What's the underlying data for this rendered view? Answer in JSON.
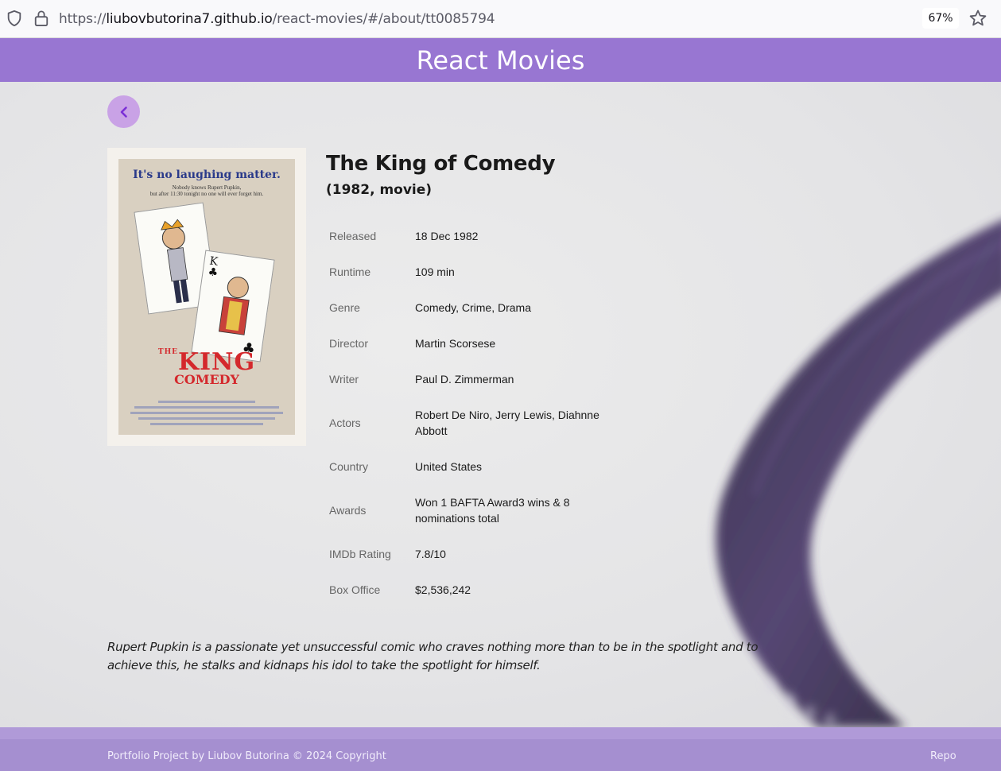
{
  "browser": {
    "url_prefix": "https://",
    "url_host": "liubovbutorina7.github.io",
    "url_path": "/react-movies/#/about/tt0085794",
    "zoom": "67%"
  },
  "header": {
    "title": "React Movies"
  },
  "movie": {
    "title": "The King of Comedy",
    "subtitle": "(1982, movie)",
    "poster": {
      "tagline": "It's no laughing matter.",
      "subline1": "Nobody knows Rupert Pupkin,",
      "subline2": "but after 11:30 tonight no one will ever forget him.",
      "title_the": "THE",
      "title_king": "KING",
      "title_comedy": "COMEDY"
    },
    "details": [
      {
        "label": "Released",
        "value": "18 Dec 1982"
      },
      {
        "label": "Runtime",
        "value": "109 min"
      },
      {
        "label": "Genre",
        "value": "Comedy, Crime, Drama"
      },
      {
        "label": "Director",
        "value": "Martin Scorsese"
      },
      {
        "label": "Writer",
        "value": "Paul D. Zimmerman"
      },
      {
        "label": "Actors",
        "value": "Robert De Niro, Jerry Lewis, Diahnne Abbott"
      },
      {
        "label": "Country",
        "value": "United States"
      },
      {
        "label": "Awards",
        "value": "Won 1 BAFTA Award3 wins & 8 nominations total"
      },
      {
        "label": "IMDb Rating",
        "value": "7.8/10"
      },
      {
        "label": "Box Office",
        "value": "$2,536,242"
      }
    ],
    "plot": "Rupert Pupkin is a passionate yet unsuccessful comic who craves nothing more than to be in the spotlight and to achieve this, he stalks and kidnaps his idol to take the spotlight for himself."
  },
  "footer": {
    "copyright": "Portfolio Project by Liubov Butorina © 2024 Copyright",
    "repo_label": "Repo"
  },
  "colors": {
    "header_bg": "#9876d2",
    "footer_bg": "#a58fd0",
    "back_button_bg": "#c9a2e6",
    "back_arrow": "#7b2fd6"
  },
  "icons": [
    "shield-icon",
    "lock-icon",
    "star-icon",
    "chevron-left-icon"
  ]
}
